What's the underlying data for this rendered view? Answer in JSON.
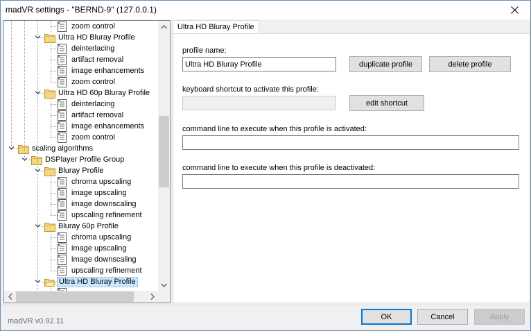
{
  "window": {
    "title": "madVR settings - \"BERND-9\" (127.0.0.1)",
    "version": "madVR v0.92.11"
  },
  "tree": {
    "rows": [
      {
        "label": "zoom control",
        "type": "page",
        "level": 4
      },
      {
        "label": "Ultra HD Bluray Profile",
        "type": "folder",
        "level": 3,
        "expanded": true
      },
      {
        "label": "deinterlacing",
        "type": "page",
        "level": 4
      },
      {
        "label": "artifact removal",
        "type": "page",
        "level": 4
      },
      {
        "label": "image enhancements",
        "type": "page",
        "level": 4
      },
      {
        "label": "zoom control",
        "type": "page",
        "level": 4
      },
      {
        "label": "Ultra HD 60p Bluray Profile",
        "type": "folder",
        "level": 3,
        "expanded": true
      },
      {
        "label": "deinterlacing",
        "type": "page",
        "level": 4
      },
      {
        "label": "artifact removal",
        "type": "page",
        "level": 4
      },
      {
        "label": "image enhancements",
        "type": "page",
        "level": 4
      },
      {
        "label": "zoom control",
        "type": "page",
        "level": 4
      },
      {
        "label": "scaling algorithms",
        "type": "folder",
        "level": 1,
        "expanded": true
      },
      {
        "label": "DSPlayer Profile Group",
        "type": "folder",
        "level": 2,
        "expanded": true
      },
      {
        "label": "Bluray Profile",
        "type": "folder",
        "level": 3,
        "expanded": true
      },
      {
        "label": "chroma upscaling",
        "type": "page",
        "level": 4
      },
      {
        "label": "image upscaling",
        "type": "page",
        "level": 4
      },
      {
        "label": "image downscaling",
        "type": "page",
        "level": 4
      },
      {
        "label": "upscaling refinement",
        "type": "page",
        "level": 4
      },
      {
        "label": "Bluray 60p Profile",
        "type": "folder",
        "level": 3,
        "expanded": true
      },
      {
        "label": "chroma upscaling",
        "type": "page",
        "level": 4
      },
      {
        "label": "image upscaling",
        "type": "page",
        "level": 4
      },
      {
        "label": "image downscaling",
        "type": "page",
        "level": 4
      },
      {
        "label": "upscaling refinement",
        "type": "page",
        "level": 4
      },
      {
        "label": "Ultra HD Bluray Profile",
        "type": "folder-open",
        "level": 3,
        "expanded": true,
        "selected": true
      },
      {
        "label": "",
        "type": "page",
        "level": 4
      }
    ]
  },
  "tab": {
    "label": "Ultra HD Bluray Profile"
  },
  "profile": {
    "name_label": "profile name:",
    "name_value": "Ultra HD Bluray Profile",
    "duplicate_button": "duplicate profile",
    "delete_button": "delete profile",
    "shortcut_label": "keyboard shortcut to activate this profile:",
    "shortcut_value": "",
    "edit_shortcut_button": "edit shortcut",
    "cmd_activated_label": "command line to execute when this profile is activated:",
    "cmd_activated_value": "",
    "cmd_deactivated_label": "command line to execute when this profile is deactivated:",
    "cmd_deactivated_value": ""
  },
  "footer": {
    "ok": "OK",
    "cancel": "Cancel",
    "apply": "Apply"
  },
  "colors": {
    "selection": "#cce8ff",
    "default_button_border": "#0078d7",
    "folder": "#f5d77f"
  }
}
